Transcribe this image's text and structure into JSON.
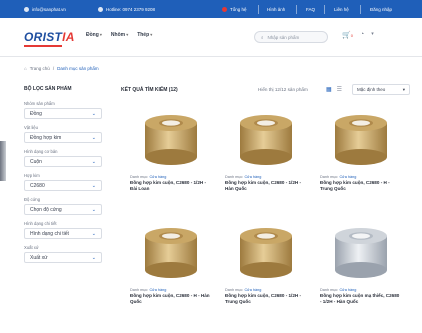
{
  "topbar": {
    "email": "info@sanphat.vn",
    "hotline": "Hotline: 0974 2379 9208",
    "items": [
      "Tổng hệ",
      "Hình ảnh",
      "FAQ",
      "Liên hệ",
      "Đăng nhập"
    ]
  },
  "header": {
    "logo_main": "ORIST",
    "logo_accent": "IA",
    "nav": [
      "Đồng",
      "Nhôm",
      "Thép"
    ],
    "search_placeholder": "Nhập sản phẩm",
    "cart_count": "0"
  },
  "breadcrumb": {
    "home": "Trang chủ",
    "current": "Danh mục sản phẩm"
  },
  "sidebar": {
    "title": "BỘ LỌC SẢN PHẨM",
    "filters": [
      {
        "label": "Nhóm sản phẩm",
        "value": "Đồng"
      },
      {
        "label": "Vật liệu",
        "value": "Đồng hợp kim"
      },
      {
        "label": "Hình dạng cơ bản",
        "value": "Cuộn"
      },
      {
        "label": "Hợp kim",
        "value": "C2680"
      },
      {
        "label": "Độ cứng",
        "value": "Chọn độ cứng"
      },
      {
        "label": "Hình dạng chi tiết",
        "value": "Hình dạng chi tiết"
      },
      {
        "label": "Xuất xứ",
        "value": "Xuất xứ"
      }
    ]
  },
  "main": {
    "title": "KẾT QUẢ TÌM KIẾM (12)",
    "result_text": "Hiển thị 12/12 sản phẩm",
    "sort_label": "Mặc định theo"
  },
  "products": [
    {
      "category": "Danh mục:",
      "brand": "Cửa hàng",
      "name": "Đồng hợp kim cuộn, C2680 - 1/2H - Đài Loan",
      "style": "brass"
    },
    {
      "category": "Danh mục:",
      "brand": "Cửa hàng",
      "name": "Đồng hợp kim cuộn, C2680 - 1/2H - Hàn Quốc",
      "style": "brass"
    },
    {
      "category": "Danh mục:",
      "brand": "Cửa hàng",
      "name": "Đồng hợp kim cuộn, C2680 - H - Trung Quốc",
      "style": "brass"
    },
    {
      "category": "Danh mục:",
      "brand": "Cửa hàng",
      "name": "Đồng hợp kim cuộn, C2680 - H - Hàn Quốc",
      "style": "brass"
    },
    {
      "category": "Danh mục:",
      "brand": "Cửa hàng",
      "name": "Đồng hợp kim cuộn, C2680 - 1/2H - Trung Quốc",
      "style": "brass"
    },
    {
      "category": "Danh mục:",
      "brand": "Cửa hàng",
      "name": "Đồng hợp kim cuộn mạ thiếc, C2680 - 1/2H - Hàn Quốc",
      "style": "silver"
    }
  ],
  "colors": {
    "brand_blue": "#1f5fb9",
    "accent_red": "#e53935",
    "brass": "#c9a766",
    "silver": "#c8cdd3"
  }
}
